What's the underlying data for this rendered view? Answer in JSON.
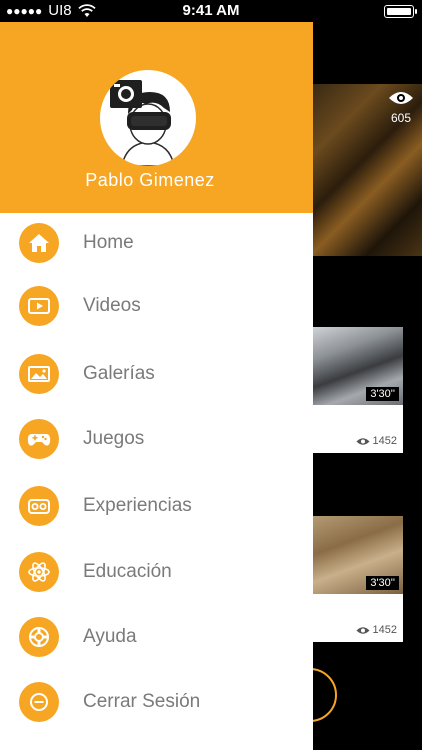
{
  "status_bar": {
    "signal": "●●●●●",
    "carrier": "UI8",
    "time": "9:41 AM"
  },
  "user": {
    "name": "Pablo  Gimenez"
  },
  "menu": {
    "items": [
      {
        "label": "Home",
        "icon": "home-icon"
      },
      {
        "label": "Videos",
        "icon": "video-icon"
      },
      {
        "label": "Galerías",
        "icon": "gallery-icon"
      },
      {
        "label": "Juegos",
        "icon": "gamepad-icon"
      },
      {
        "label": "Experiencias",
        "icon": "vr-headset-icon"
      },
      {
        "label": "Educación",
        "icon": "atom-icon"
      },
      {
        "label": "Ayuda",
        "icon": "lifebuoy-icon"
      },
      {
        "label": "Cerrar Sesión",
        "icon": "minus-circle-icon"
      }
    ]
  },
  "background": {
    "hero_views": "605",
    "cards": [
      {
        "duration": "3'30''",
        "views": "1452"
      },
      {
        "duration": "3'30''",
        "views": "1452"
      }
    ]
  },
  "colors": {
    "accent": "#f6a623",
    "menu_text": "#7a7a7a"
  }
}
